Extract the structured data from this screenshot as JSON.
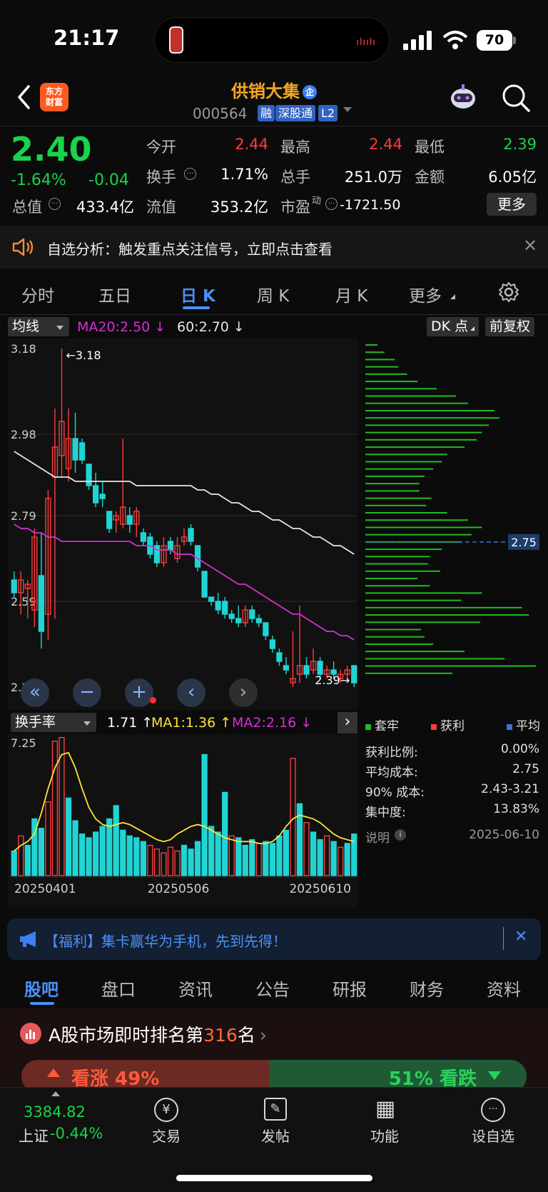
{
  "status_bar": {
    "time": "21:17",
    "battery": "70"
  },
  "header": {
    "logo_text": "东方\n财富",
    "stock_name": "供销大集",
    "enterprise_badge": "企",
    "code": "000564",
    "tags": [
      "融",
      "深股通",
      "L2"
    ]
  },
  "quote": {
    "price": "2.40",
    "change_pct": "-1.64%",
    "change": "-0.04",
    "open_label": "今开",
    "open": "2.44",
    "high_label": "最高",
    "high": "2.44",
    "low_label": "最低",
    "low": "2.39",
    "turnover_label": "换手",
    "turnover": "1.71%",
    "volume_label": "总手",
    "volume": "251.0万",
    "amount_label": "金额",
    "amount": "6.05亿",
    "mktcap_label": "总值",
    "mktcap": "433.4亿",
    "float_label": "流值",
    "float": "353.2亿",
    "pe_label": "市盈",
    "pe_sup": "动",
    "pe": "-1721.50",
    "more": "更多"
  },
  "notice": {
    "text": "自选分析：触发重点关注信号，立即点击查看"
  },
  "period_tabs": [
    {
      "label": "分时",
      "active": false
    },
    {
      "label": "五日",
      "active": false
    },
    {
      "label": "日 K",
      "active": true
    },
    {
      "label": "周 K",
      "active": false
    },
    {
      "label": "月 K",
      "active": false
    },
    {
      "label": "更多",
      "active": false
    }
  ],
  "chart_toolbar": {
    "ma_select": "均线",
    "ma20": "MA20:2.50 ↓",
    "ma60": "60:2.70 ↓",
    "dk_button": "DK 点",
    "adjust_button": "前复权"
  },
  "chart_data": [
    {
      "type": "candlestick",
      "title": "日 K",
      "price_labels": [
        "3.18",
        "2.98",
        "2.79",
        "2.59",
        "2.39"
      ],
      "ylim": [
        2.38,
        3.18
      ],
      "annotations": {
        "high": "←3.18",
        "low": "2.39→",
        "cost": "2.75"
      },
      "candles": [
        {
          "o": 2.64,
          "h": 2.66,
          "l": 2.6,
          "c": 2.61
        },
        {
          "o": 2.61,
          "h": 2.66,
          "l": 2.56,
          "c": 2.64
        },
        {
          "o": 2.62,
          "h": 2.64,
          "l": 2.55,
          "c": 2.63
        },
        {
          "o": 2.57,
          "h": 2.76,
          "l": 2.53,
          "c": 2.74
        },
        {
          "o": 2.65,
          "h": 2.75,
          "l": 2.48,
          "c": 2.52
        },
        {
          "o": 2.56,
          "h": 2.85,
          "l": 2.5,
          "c": 2.83
        },
        {
          "o": 2.88,
          "h": 3.04,
          "l": 2.55,
          "c": 2.95
        },
        {
          "o": 2.93,
          "h": 3.18,
          "l": 2.88,
          "c": 3.01
        },
        {
          "o": 2.9,
          "h": 3.04,
          "l": 2.87,
          "c": 2.97
        },
        {
          "o": 2.97,
          "h": 3.03,
          "l": 2.89,
          "c": 2.92
        },
        {
          "o": 2.96,
          "h": 2.97,
          "l": 2.91,
          "c": 2.92
        },
        {
          "o": 2.91,
          "h": 2.91,
          "l": 2.85,
          "c": 2.86
        },
        {
          "o": 2.86,
          "h": 2.89,
          "l": 2.81,
          "c": 2.82
        },
        {
          "o": 2.84,
          "h": 2.87,
          "l": 2.81,
          "c": 2.83
        },
        {
          "o": 2.8,
          "h": 2.8,
          "l": 2.75,
          "c": 2.76
        },
        {
          "o": 2.78,
          "h": 2.8,
          "l": 2.75,
          "c": 2.79
        },
        {
          "o": 2.77,
          "h": 2.97,
          "l": 2.76,
          "c": 2.81
        },
        {
          "o": 2.79,
          "h": 2.81,
          "l": 2.75,
          "c": 2.77
        },
        {
          "o": 2.77,
          "h": 2.81,
          "l": 2.74,
          "c": 2.8
        },
        {
          "o": 2.75,
          "h": 2.76,
          "l": 2.72,
          "c": 2.73
        },
        {
          "o": 2.74,
          "h": 2.75,
          "l": 2.69,
          "c": 2.7
        },
        {
          "o": 2.72,
          "h": 2.73,
          "l": 2.67,
          "c": 2.68
        },
        {
          "o": 2.68,
          "h": 2.74,
          "l": 2.67,
          "c": 2.72
        },
        {
          "o": 2.73,
          "h": 2.74,
          "l": 2.7,
          "c": 2.71
        },
        {
          "o": 2.69,
          "h": 2.74,
          "l": 2.68,
          "c": 2.72
        },
        {
          "o": 2.73,
          "h": 2.76,
          "l": 2.72,
          "c": 2.74
        },
        {
          "o": 2.76,
          "h": 2.77,
          "l": 2.72,
          "c": 2.73
        },
        {
          "o": 2.72,
          "h": 2.72,
          "l": 2.66,
          "c": 2.67
        },
        {
          "o": 2.66,
          "h": 2.66,
          "l": 2.6,
          "c": 2.6
        },
        {
          "o": 2.6,
          "h": 2.6,
          "l": 2.58,
          "c": 2.59
        },
        {
          "o": 2.59,
          "h": 2.61,
          "l": 2.56,
          "c": 2.57
        },
        {
          "o": 2.59,
          "h": 2.6,
          "l": 2.55,
          "c": 2.56
        },
        {
          "o": 2.56,
          "h": 2.57,
          "l": 2.54,
          "c": 2.55
        },
        {
          "o": 2.55,
          "h": 2.58,
          "l": 2.53,
          "c": 2.54
        },
        {
          "o": 2.54,
          "h": 2.58,
          "l": 2.53,
          "c": 2.57
        },
        {
          "o": 2.57,
          "h": 2.58,
          "l": 2.54,
          "c": 2.55
        },
        {
          "o": 2.55,
          "h": 2.56,
          "l": 2.53,
          "c": 2.54
        },
        {
          "o": 2.54,
          "h": 2.54,
          "l": 2.5,
          "c": 2.51
        },
        {
          "o": 2.5,
          "h": 2.51,
          "l": 2.47,
          "c": 2.48
        },
        {
          "o": 2.47,
          "h": 2.48,
          "l": 2.44,
          "c": 2.45
        },
        {
          "o": 2.44,
          "h": 2.46,
          "l": 2.42,
          "c": 2.43
        },
        {
          "o": 2.4,
          "h": 2.52,
          "l": 2.39,
          "c": 2.41
        },
        {
          "o": 2.42,
          "h": 2.58,
          "l": 2.4,
          "c": 2.44
        },
        {
          "o": 2.44,
          "h": 2.46,
          "l": 2.41,
          "c": 2.42
        },
        {
          "o": 2.43,
          "h": 2.48,
          "l": 2.42,
          "c": 2.45
        },
        {
          "o": 2.45,
          "h": 2.46,
          "l": 2.41,
          "c": 2.42
        },
        {
          "o": 2.42,
          "h": 2.44,
          "l": 2.41,
          "c": 2.43
        },
        {
          "o": 2.43,
          "h": 2.45,
          "l": 2.41,
          "c": 2.42
        },
        {
          "o": 2.41,
          "h": 2.43,
          "l": 2.4,
          "c": 2.42
        },
        {
          "o": 2.42,
          "h": 2.44,
          "l": 2.41,
          "c": 2.43
        },
        {
          "o": 2.44,
          "h": 2.44,
          "l": 2.39,
          "c": 2.4
        }
      ],
      "ma20": [
        2.77,
        2.76,
        2.76,
        2.75,
        2.75,
        2.74,
        2.74,
        2.73,
        2.73,
        2.73,
        2.73,
        2.73,
        2.73,
        2.73,
        2.73,
        2.73,
        2.73,
        2.73,
        2.72,
        2.72,
        2.72,
        2.71,
        2.71,
        2.71,
        2.7,
        2.7,
        2.7,
        2.69,
        2.68,
        2.67,
        2.66,
        2.65,
        2.64,
        2.63,
        2.63,
        2.62,
        2.61,
        2.6,
        2.59,
        2.58,
        2.57,
        2.56,
        2.56,
        2.55,
        2.54,
        2.53,
        2.52,
        2.52,
        2.51,
        2.51,
        2.5
      ],
      "ma60": [
        2.94,
        2.93,
        2.92,
        2.91,
        2.9,
        2.89,
        2.88,
        2.88,
        2.88,
        2.87,
        2.87,
        2.87,
        2.87,
        2.87,
        2.87,
        2.87,
        2.87,
        2.87,
        2.86,
        2.86,
        2.86,
        2.86,
        2.86,
        2.86,
        2.86,
        2.86,
        2.86,
        2.85,
        2.85,
        2.84,
        2.84,
        2.83,
        2.82,
        2.82,
        2.81,
        2.8,
        2.8,
        2.79,
        2.78,
        2.78,
        2.77,
        2.76,
        2.76,
        2.75,
        2.74,
        2.74,
        2.73,
        2.72,
        2.72,
        2.71,
        2.7
      ],
      "chip_bars": [
        0.07,
        0.11,
        0.17,
        0.19,
        0.24,
        0.3,
        0.41,
        0.52,
        0.59,
        0.74,
        0.77,
        0.71,
        0.67,
        0.64,
        0.57,
        0.47,
        0.44,
        0.39,
        0.34,
        0.31,
        0.31,
        0.38,
        0.35,
        0.47,
        0.59,
        0.67,
        0.61,
        0.55,
        0.44,
        0.37,
        0.36,
        0.43,
        0.3,
        0.37,
        0.67,
        0.55,
        0.9,
        0.94,
        0.66,
        0.32,
        0.34,
        0.39,
        0.57,
        0.8,
        0.98,
        0.5
      ],
      "chip_cost_index": 27
    },
    {
      "type": "bar",
      "title": "换手率",
      "ylabel": "7.25",
      "ylim": [
        0,
        7.25
      ],
      "x_labels": [
        "20250401",
        "20250506",
        "20250610"
      ],
      "values": [
        1.3,
        2.1,
        1.6,
        3.0,
        2.5,
        3.9,
        7.1,
        7.3,
        4.1,
        2.9,
        2.2,
        2.0,
        2.3,
        2.6,
        3.0,
        3.7,
        2.4,
        2.1,
        2.0,
        1.8,
        1.6,
        1.4,
        1.2,
        1.5,
        1.3,
        1.6,
        1.4,
        1.8,
        6.4,
        2.6,
        2.3,
        4.4,
        2.1,
        2.0,
        1.6,
        1.9,
        1.7,
        1.8,
        1.7,
        2.1,
        2.4,
        6.2,
        3.8,
        2.8,
        2.3,
        1.9,
        2.1,
        1.8,
        1.5,
        1.7,
        2.2
      ],
      "up": [
        0,
        1,
        0,
        0,
        0,
        1,
        1,
        1,
        0,
        0,
        0,
        0,
        0,
        0,
        0,
        0,
        0,
        0,
        0,
        0,
        1,
        1,
        1,
        1,
        1,
        0,
        0,
        0,
        0,
        0,
        0,
        0,
        1,
        0,
        0,
        0,
        1,
        0,
        0,
        0,
        0,
        1,
        0,
        1,
        0,
        0,
        1,
        0,
        1,
        0,
        0
      ],
      "ma1": [
        1.3,
        1.6,
        1.8,
        2.2,
        3.3,
        4.6,
        5.7,
        6.4,
        6.5,
        5.7,
        4.6,
        3.6,
        3.0,
        2.7,
        2.6,
        2.7,
        2.8,
        2.7,
        2.5,
        2.3,
        2.1,
        1.9,
        1.8,
        1.9,
        2.2,
        2.4,
        2.6,
        2.7,
        2.6,
        2.4,
        2.2,
        2.0,
        1.9,
        1.8,
        1.8,
        1.8,
        1.7,
        1.7,
        1.8,
        2.1,
        2.6,
        3.0,
        3.2,
        3.1,
        3.0,
        2.8,
        2.5,
        2.2,
        2.0,
        1.9,
        1.8
      ],
      "ma2": [
        1.5,
        1.8,
        2.2,
        2.7,
        3.2,
        3.6,
        3.9,
        4.1,
        4.2,
        4.2,
        4.0,
        3.8,
        3.5,
        3.2,
        3.0,
        2.8,
        2.7,
        2.6,
        2.5,
        2.4,
        2.3,
        2.2,
        2.1,
        2.1,
        2.1,
        2.1,
        2.2,
        2.3,
        2.3,
        2.3,
        2.3,
        2.3,
        2.2,
        2.2,
        2.2,
        2.2,
        2.2,
        2.2,
        2.2,
        2.2,
        2.2,
        2.3,
        2.4,
        2.4,
        2.4,
        2.4,
        2.4,
        2.3,
        2.3,
        2.2,
        2.2
      ]
    }
  ],
  "volume_toolbar": {
    "select": "换手率",
    "value": "1.71 ↑",
    "ma1": "MA1:1.36 ↑",
    "ma2": "MA2:2.16 ↓"
  },
  "chip_panel": {
    "legend": [
      "套牢",
      "获利",
      "平均"
    ],
    "stats": [
      {
        "label": "获利比例:",
        "value": "0.00%"
      },
      {
        "label": "平均成本:",
        "value": "2.75"
      },
      {
        "label": "90% 成本:",
        "value": "2.43-3.21"
      },
      {
        "label": "集中度:",
        "value": "13.83%"
      }
    ],
    "note_label": "说明",
    "date": "2025-06-10"
  },
  "banner": {
    "text": "【福利】集卡赢华为手机，先到先得！"
  },
  "section_tabs": [
    {
      "label": "股吧",
      "active": true
    },
    {
      "label": "盘口",
      "active": false
    },
    {
      "label": "资讯",
      "active": false
    },
    {
      "label": "公告",
      "active": false
    },
    {
      "label": "研报",
      "active": false
    },
    {
      "label": "财务",
      "active": false
    },
    {
      "label": "资料",
      "active": false
    }
  ],
  "rank": {
    "prefix": "A股市场即时排名第",
    "number": "316",
    "suffix": "名",
    "bull": "看涨 49%",
    "bear": "51% 看跌"
  },
  "bottom_nav": {
    "index_value": "3384.82",
    "index_label": "上证",
    "index_change": "-0.44%",
    "items": [
      "交易",
      "发帖",
      "功能",
      "设自选"
    ],
    "icons": [
      "¥",
      "✎",
      "▦",
      "···"
    ]
  },
  "colors": {
    "up": "#ff3b3b",
    "down": "#21d4d4",
    "ma20": "#d62fd6",
    "ma60": "#e6e6e6",
    "ma1": "#ffe23a",
    "chip": "#1fbb1f",
    "accent": "#4c8ff7"
  }
}
